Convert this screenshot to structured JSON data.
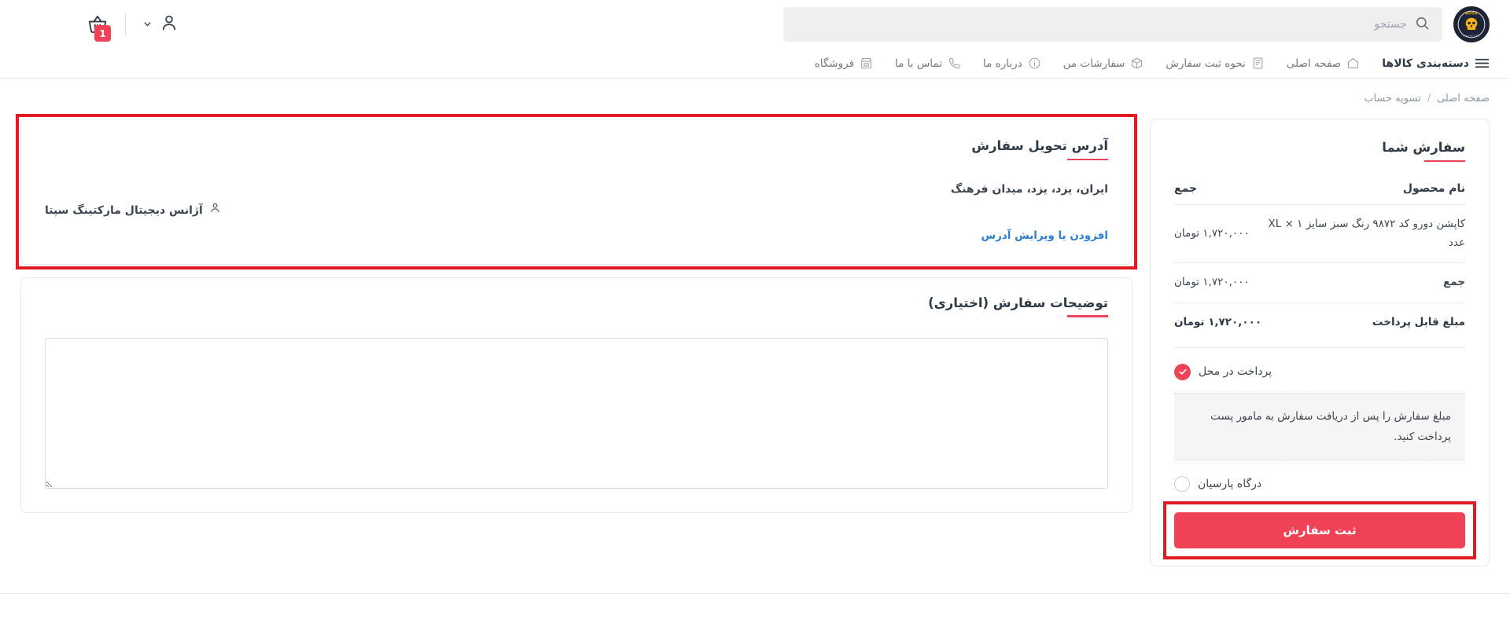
{
  "header": {
    "logo_alt": "NOOR COLLECTION",
    "logo_text_top": "NOOR",
    "logo_text_bottom": "COLLECTION",
    "search_placeholder": "جستجو",
    "search_value": "",
    "cart_badge": "1"
  },
  "nav": {
    "items": [
      {
        "label": "دسته‌بندی کالاها",
        "icon": "hamburger-icon",
        "key": "categories"
      },
      {
        "label": "صفحه اصلی",
        "icon": "home-icon",
        "key": "home"
      },
      {
        "label": "نحوه ثبت سفارش",
        "icon": "document-icon",
        "key": "how-to-order"
      },
      {
        "label": "سفارشات من",
        "icon": "box-icon",
        "key": "my-orders"
      },
      {
        "label": "درباره ما",
        "icon": "info-icon",
        "key": "about-us"
      },
      {
        "label": "تماس با ما",
        "icon": "phone-icon",
        "key": "contact-us"
      },
      {
        "label": "فروشگاه",
        "icon": "store-icon",
        "key": "shop"
      }
    ]
  },
  "breadcrumb": {
    "home": "صفحه اصلی",
    "separator": "/",
    "current": "تسویه حساب"
  },
  "address_card": {
    "title": "آدرس تحویل سفارش",
    "line1": "ایران، یزد، یزد، میدان فرهنگ",
    "line2": "آژانس دیجیتال مارکتینگ سپتا",
    "edit_link": "افزودن یا ویرایش آدرس",
    "highlighted": true
  },
  "notes_card": {
    "title": "توضیحات سفارش (اختیاری)",
    "textarea_value": "",
    "textarea_placeholder": ""
  },
  "order_card": {
    "title": "سفارش شما",
    "columns": {
      "product": "نام محصول",
      "total": "جمع"
    },
    "items": [
      {
        "name": "کاپشن دورو کد ۹۸۷۲ رنگ سبز سایز XL × ۱ عدد",
        "total": "۱,۷۲۰,۰۰۰ تومان"
      }
    ],
    "subtotal_label": "جمع",
    "subtotal_value": "۱,۷۲۰,۰۰۰ تومان",
    "payable_label": "مبلغ قابل پرداخت",
    "payable_value": "۱,۷۲۰,۰۰۰ تومان",
    "payment_methods": [
      {
        "label": "پرداخت در محل",
        "selected": true
      },
      {
        "label": "درگاه پارسیان",
        "selected": false
      }
    ],
    "payment_note": "مبلغ سفارش را پس از دریافت سفارش به مامور پست پرداخت کنید.",
    "submit_label": "ثبت سفارش",
    "submit_highlighted": true
  },
  "colors": {
    "accent_red": "#ef4256",
    "highlight_red": "#e01b24",
    "link_blue": "#2d7fd3",
    "text_dark": "#2e3a46",
    "muted": "#8d97a1",
    "logo_navy": "#1c2436",
    "logo_gold": "#f5b31c"
  }
}
